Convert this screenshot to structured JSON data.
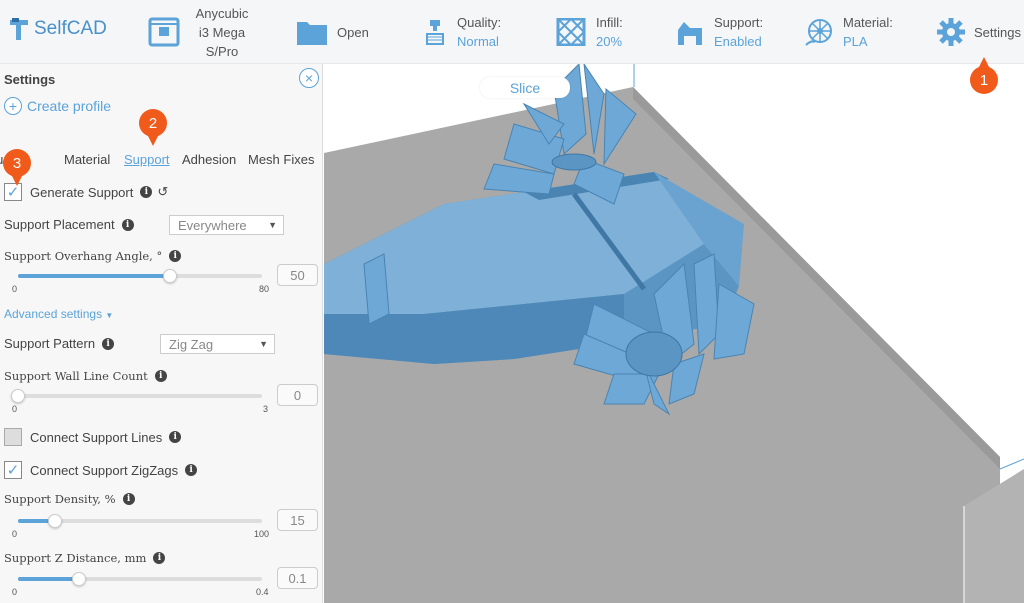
{
  "app": {
    "logo_text": "SelfCAD"
  },
  "toolbar": {
    "printer": {
      "line1": "Anycubic",
      "line2": "i3 Mega",
      "line3": "S/Pro"
    },
    "open": {
      "label": "Open"
    },
    "quality": {
      "label": "Quality:",
      "value": "Normal"
    },
    "infill": {
      "label": "Infill:",
      "value": "20%"
    },
    "support": {
      "label": "Support:",
      "value": "Enabled"
    },
    "material": {
      "label": "Material:",
      "value": "PLA"
    },
    "settings": {
      "label": "Settings"
    }
  },
  "badges": {
    "b1": "1",
    "b2": "2",
    "b3": "3"
  },
  "panel": {
    "title": "Settings",
    "close": "×",
    "create_profile": "Create profile",
    "tabs": [
      "Quality",
      "Material",
      "Support",
      "Adhesion",
      "Mesh Fixes"
    ],
    "active_tab": "Support",
    "generate_support": {
      "label": "Generate Support",
      "checked": true
    },
    "support_placement": {
      "label": "Support Placement",
      "value": "Everywhere"
    },
    "overhang": {
      "label": "Support Overhang Angle, °",
      "min": "0",
      "max": "80",
      "value": "50"
    },
    "advanced": "Advanced settings",
    "pattern": {
      "label": "Support Pattern",
      "value": "Zig Zag"
    },
    "wall_line_count": {
      "label": "Support Wall Line Count",
      "min": "0",
      "max": "3",
      "value": "0"
    },
    "connect_lines": {
      "label": "Connect Support Lines",
      "checked": false
    },
    "connect_zigzags": {
      "label": "Connect Support ZigZags",
      "checked": true
    },
    "density": {
      "label": "Support Density, %",
      "min": "0",
      "max": "100",
      "value": "15"
    },
    "z_distance": {
      "label": "Support Z Distance, mm",
      "min": "0",
      "max": "0.4",
      "value": "0.1"
    }
  },
  "viewport": {
    "slice_label": "Slice"
  },
  "colors": {
    "accent": "#5ba3d9",
    "badge": "#f05a1a",
    "model": "#5b95c3",
    "plate": "#a9a9a9"
  }
}
